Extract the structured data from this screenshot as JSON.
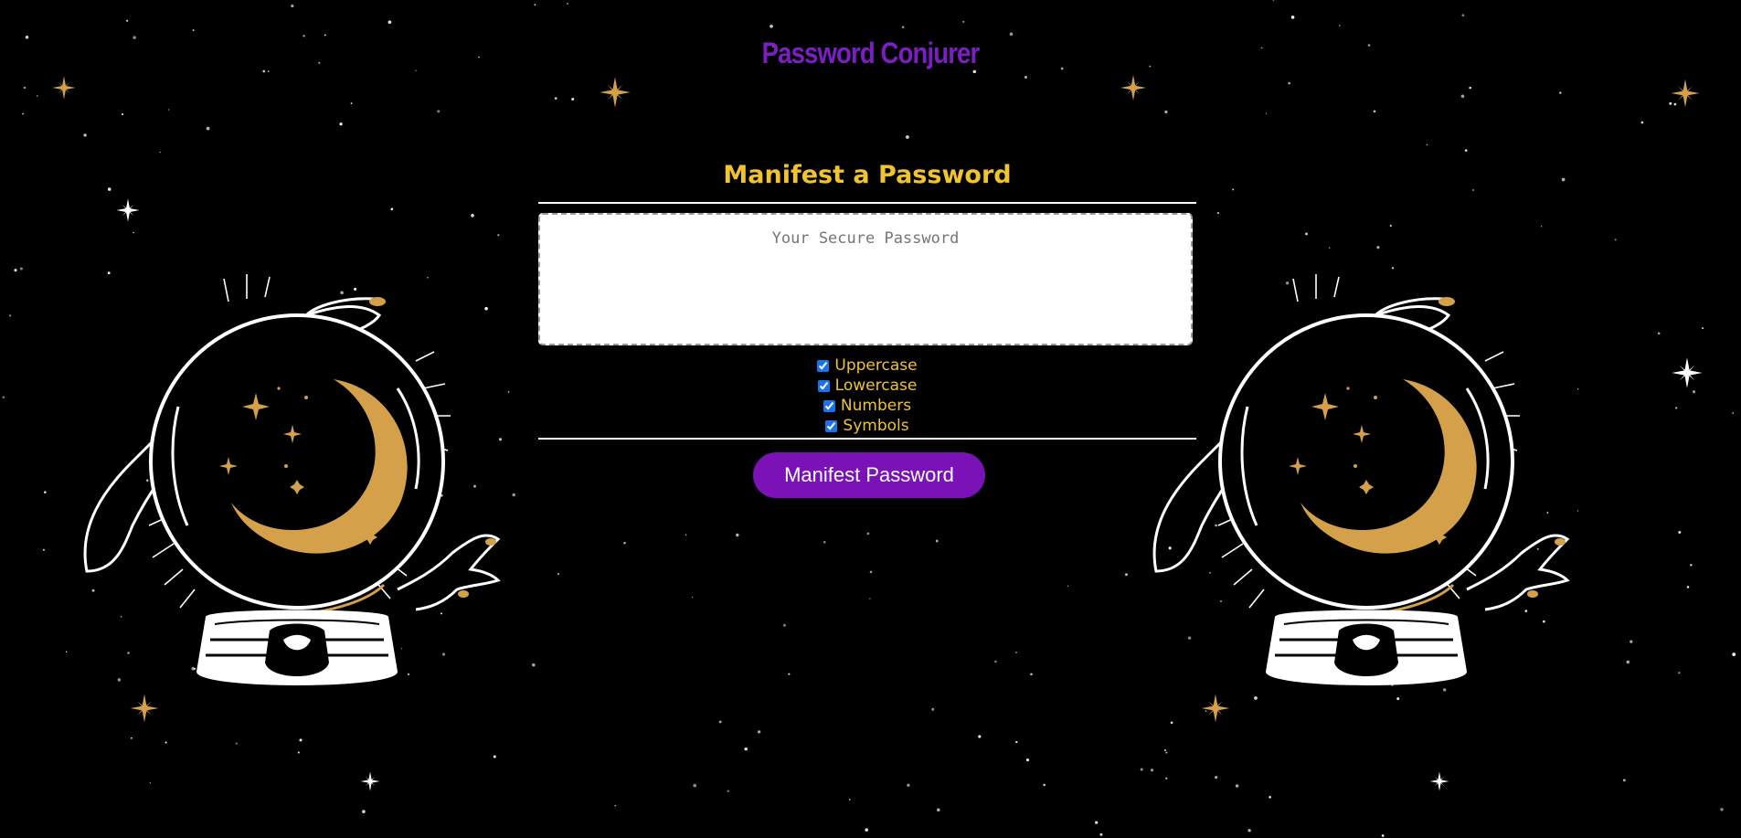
{
  "site": {
    "title": "Password Conjurer"
  },
  "generator": {
    "heading": "Manifest a Password",
    "password": {
      "value": "",
      "placeholder": "Your Secure Password"
    },
    "options": [
      {
        "label": "Uppercase",
        "checked": true
      },
      {
        "label": "Lowercase",
        "checked": true
      },
      {
        "label": "Numbers",
        "checked": true
      },
      {
        "label": "Symbols",
        "checked": true
      }
    ],
    "button_label": "Manifest Password"
  },
  "decor": {
    "illustration": "hand-over-crystal-ball-with-crescent-moon",
    "colors": {
      "background": "#000000",
      "title": "#7b1fc2",
      "heading": "#f0c330",
      "gold": "#d4a04a",
      "button": "#7a12b8"
    }
  }
}
